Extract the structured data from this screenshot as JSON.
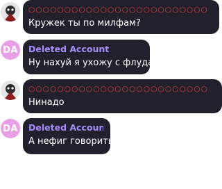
{
  "colors": {
    "bubble_bg": "#23202e",
    "name_purple": "#a58dfa",
    "name_red": "#e8453c",
    "avatar_pink": "#e99fe6",
    "text": "#ffffff"
  },
  "messages": [
    {
      "sender": "○○○○○○○○○○○○○○○○○○○○○○○○○",
      "avatar_type": "image",
      "text": "Кружек ты по милфам?"
    },
    {
      "sender": "Deleted Account",
      "avatar_initials": "DA",
      "text": "Ну нахуй я ухожу с флуда"
    },
    {
      "sender": "○○○○○○○○○○○○○○○○○○○○○○○○○",
      "avatar_type": "image",
      "text": "Нинадо"
    },
    {
      "sender": "Deleted Account",
      "avatar_initials": "DA",
      "text": "А нефиг говорить да"
    }
  ]
}
